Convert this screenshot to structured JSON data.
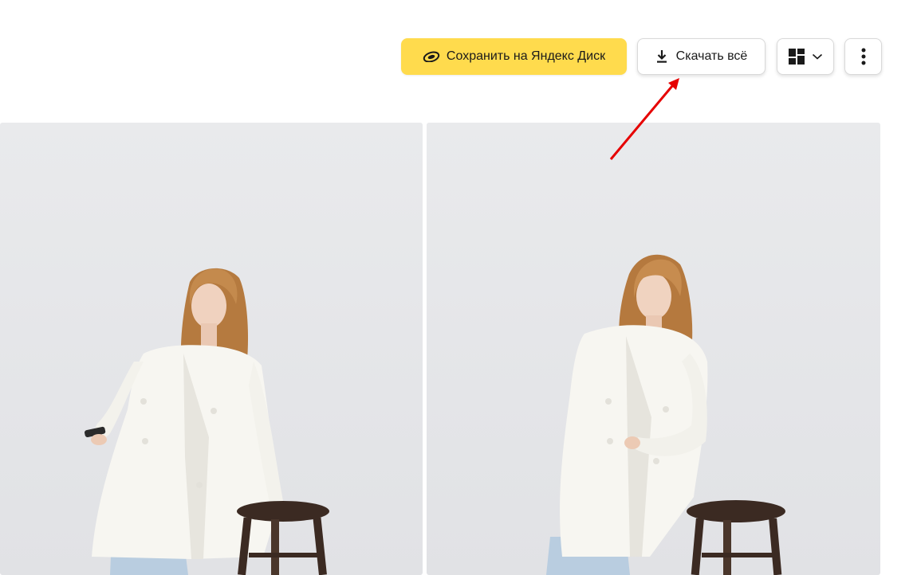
{
  "toolbar": {
    "save_label": "Сохранить на Яндекс Диск",
    "download_label": "Скачать всё",
    "save_icon": "yandex-disk-icon",
    "download_icon": "download-icon",
    "view_icon": "grid-layout-icon",
    "view_chevron_icon": "chevron-down-icon",
    "more_icon": "more-vertical-icon"
  },
  "gallery": {
    "photos": [
      {
        "subject": "woman in white blazer with stool"
      },
      {
        "subject": "woman in white blazer with stool"
      }
    ]
  },
  "colors": {
    "save_button_bg": "#ffdb4d",
    "annotation_arrow": "#e60000",
    "photo_background": "#e6e7ea"
  }
}
